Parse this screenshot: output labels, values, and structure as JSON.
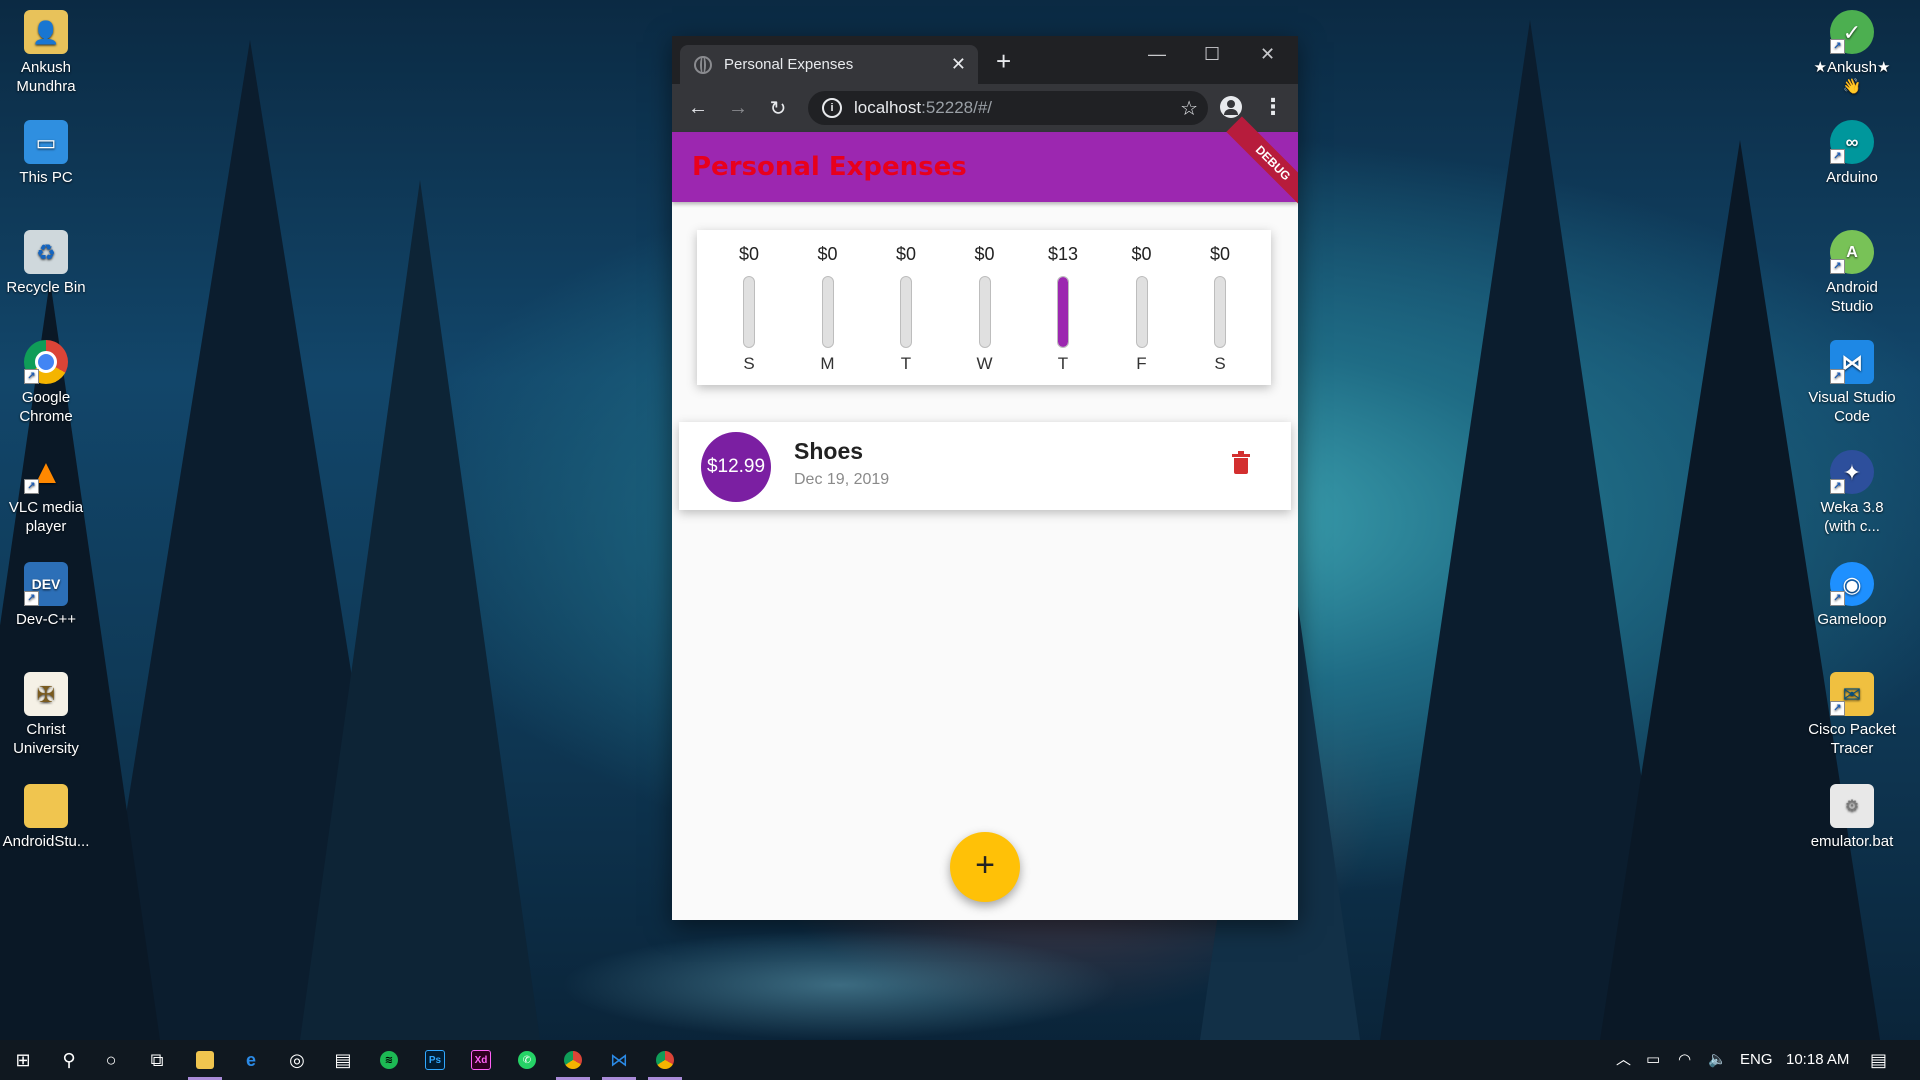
{
  "desktop": {
    "left_icons": [
      {
        "label": "Ankush\nMundhra",
        "icon": "user-folder-icon"
      },
      {
        "label": "This PC",
        "icon": "computer-icon"
      },
      {
        "label": "Recycle Bin",
        "icon": "recycle-bin-icon"
      },
      {
        "label": "Google\nChrome",
        "icon": "chrome-icon"
      },
      {
        "label": "VLC media\nplayer",
        "icon": "vlc-icon"
      },
      {
        "label": "Dev-C++",
        "icon": "devcpp-icon"
      },
      {
        "label": "Christ\nUniversity",
        "icon": "christ-university-icon"
      },
      {
        "label": "AndroidStu...",
        "icon": "folder-icon"
      }
    ],
    "right_icons": [
      {
        "label": "★Ankush★\n👋",
        "icon": "check-folder-icon"
      },
      {
        "label": "Arduino",
        "icon": "arduino-icon"
      },
      {
        "label": "Android\nStudio",
        "icon": "android-studio-icon"
      },
      {
        "label": "Visual Studio\nCode",
        "icon": "vscode-icon"
      },
      {
        "label": "Weka 3.8\n(with c...",
        "icon": "weka-icon"
      },
      {
        "label": "Gameloop",
        "icon": "gameloop-icon"
      },
      {
        "label": "Cisco Packet\nTracer",
        "icon": "cisco-packet-tracer-icon"
      },
      {
        "label": "emulator.bat",
        "icon": "batch-file-icon"
      }
    ]
  },
  "browser": {
    "tab_title": "Personal Expenses",
    "url_host": "localhost",
    "url_rest": ":52228/#/",
    "controls": {
      "minimize": "—",
      "maximize": "☐",
      "close": "✕",
      "new_tab": "+"
    }
  },
  "app": {
    "title": "Personal Expenses",
    "debug_banner": "DEBUG",
    "accent_color": "#9c27b0",
    "title_color": "#e8001c",
    "chart": {
      "days": [
        {
          "day": "S",
          "amount": "$0",
          "fraction": 0
        },
        {
          "day": "M",
          "amount": "$0",
          "fraction": 0
        },
        {
          "day": "T",
          "amount": "$0",
          "fraction": 0
        },
        {
          "day": "W",
          "amount": "$0",
          "fraction": 0
        },
        {
          "day": "T",
          "amount": "$13",
          "fraction": 1
        },
        {
          "day": "F",
          "amount": "$0",
          "fraction": 0
        },
        {
          "day": "S",
          "amount": "$0",
          "fraction": 0
        }
      ]
    },
    "transactions": [
      {
        "amount": "$12.99",
        "title": "Shoes",
        "date": "Dec 19, 2019"
      }
    ],
    "fab_label": "+"
  },
  "taskbar": {
    "apps": [
      "start-icon",
      "search-icon",
      "cortana-icon",
      "task-view-icon",
      "file-explorer-icon",
      "edge-icon",
      "groove-icon",
      "store-icon",
      "spotify-icon",
      "photoshop-icon",
      "xd-icon",
      "whatsapp-icon",
      "chrome-icon",
      "vscode-icon",
      "chrome-icon-2"
    ],
    "photoshop_label": "Ps",
    "xd_label": "Xd",
    "language": "ENG",
    "time": "10:18 AM"
  }
}
